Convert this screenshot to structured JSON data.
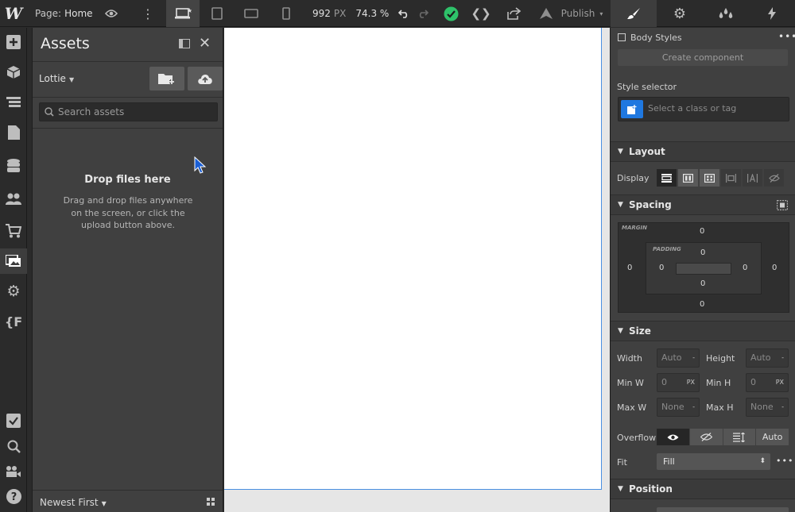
{
  "topbar": {
    "logo": "W",
    "page_label": "Page:",
    "page_name": "Home",
    "width_value": "992",
    "width_unit": "PX",
    "zoom": "74.3 %",
    "publish_label": "Publish",
    "status_color": "#2ec26a"
  },
  "assets": {
    "title": "Assets",
    "filter_label": "Lottie",
    "search_placeholder": "Search assets",
    "drop_title": "Drop files here",
    "drop_sub": "Drag and drop files anywhere on the screen, or click the upload button above.",
    "sort_label": "Newest First"
  },
  "right": {
    "body_styles": "Body Styles",
    "create_component": "Create component",
    "style_selector_label": "Style selector",
    "style_selector_placeholder": "Select a class or tag",
    "layout_title": "Layout",
    "display_label": "Display",
    "spacing_title": "Spacing",
    "margin_label": "MARGIN",
    "padding_label": "PADDING",
    "margin": {
      "top": "0",
      "right": "0",
      "bottom": "0",
      "left": "0"
    },
    "padding": {
      "top": "0",
      "right": "0",
      "bottom": "0",
      "left": "0"
    },
    "size_title": "Size",
    "width_label": "Width",
    "width_value": "Auto",
    "height_label": "Height",
    "height_value": "Auto",
    "minw_label": "Min W",
    "minw_value": "0",
    "minw_unit": "PX",
    "minh_label": "Min H",
    "minh_value": "0",
    "minh_unit": "PX",
    "maxw_label": "Max W",
    "maxw_value": "None",
    "maxh_label": "Max H",
    "maxh_value": "None",
    "dash": "-",
    "overflow_label": "Overflow",
    "overflow_auto": "Auto",
    "fit_label": "Fit",
    "fit_value": "Fill",
    "position_title": "Position"
  }
}
